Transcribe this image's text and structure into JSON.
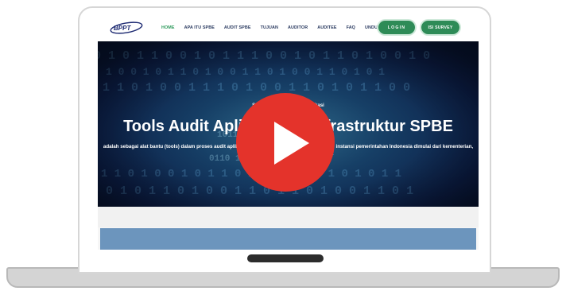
{
  "nav": {
    "logo_text": "BPPT",
    "items": [
      "HOME",
      "APA ITU SPBE",
      "AUDIT SPBE",
      "TUJUAN",
      "AUDITOR",
      "AUDITEE",
      "FAQ",
      "UNDUH"
    ],
    "active_item": "HOME",
    "login_label": "LOGIN",
    "survey_label": "ISI SURVEY"
  },
  "hero": {
    "welcome": "Selamat Datang di Web Aplikasi",
    "title": "Tools Audit Aplikasi dan Infrastruktur SPBE",
    "description": "adalah sebagai alat bantu (tools) dalam proses audit aplikasi dan infrastruktur SPBE untuk seluruh instansi pemerintahan Indonesia dimulai dari kementerian, lembaga, provinsi dan kabupaten/kota."
  },
  "colors": {
    "accent": "#2e8b57",
    "nav_active": "#2e9a5c",
    "play_button": "#e4332b",
    "hero_bg": "#0b1c44",
    "footer_band": "#6c95bd"
  },
  "icons": {
    "play": "play-icon",
    "logo": "bppt-logo"
  }
}
